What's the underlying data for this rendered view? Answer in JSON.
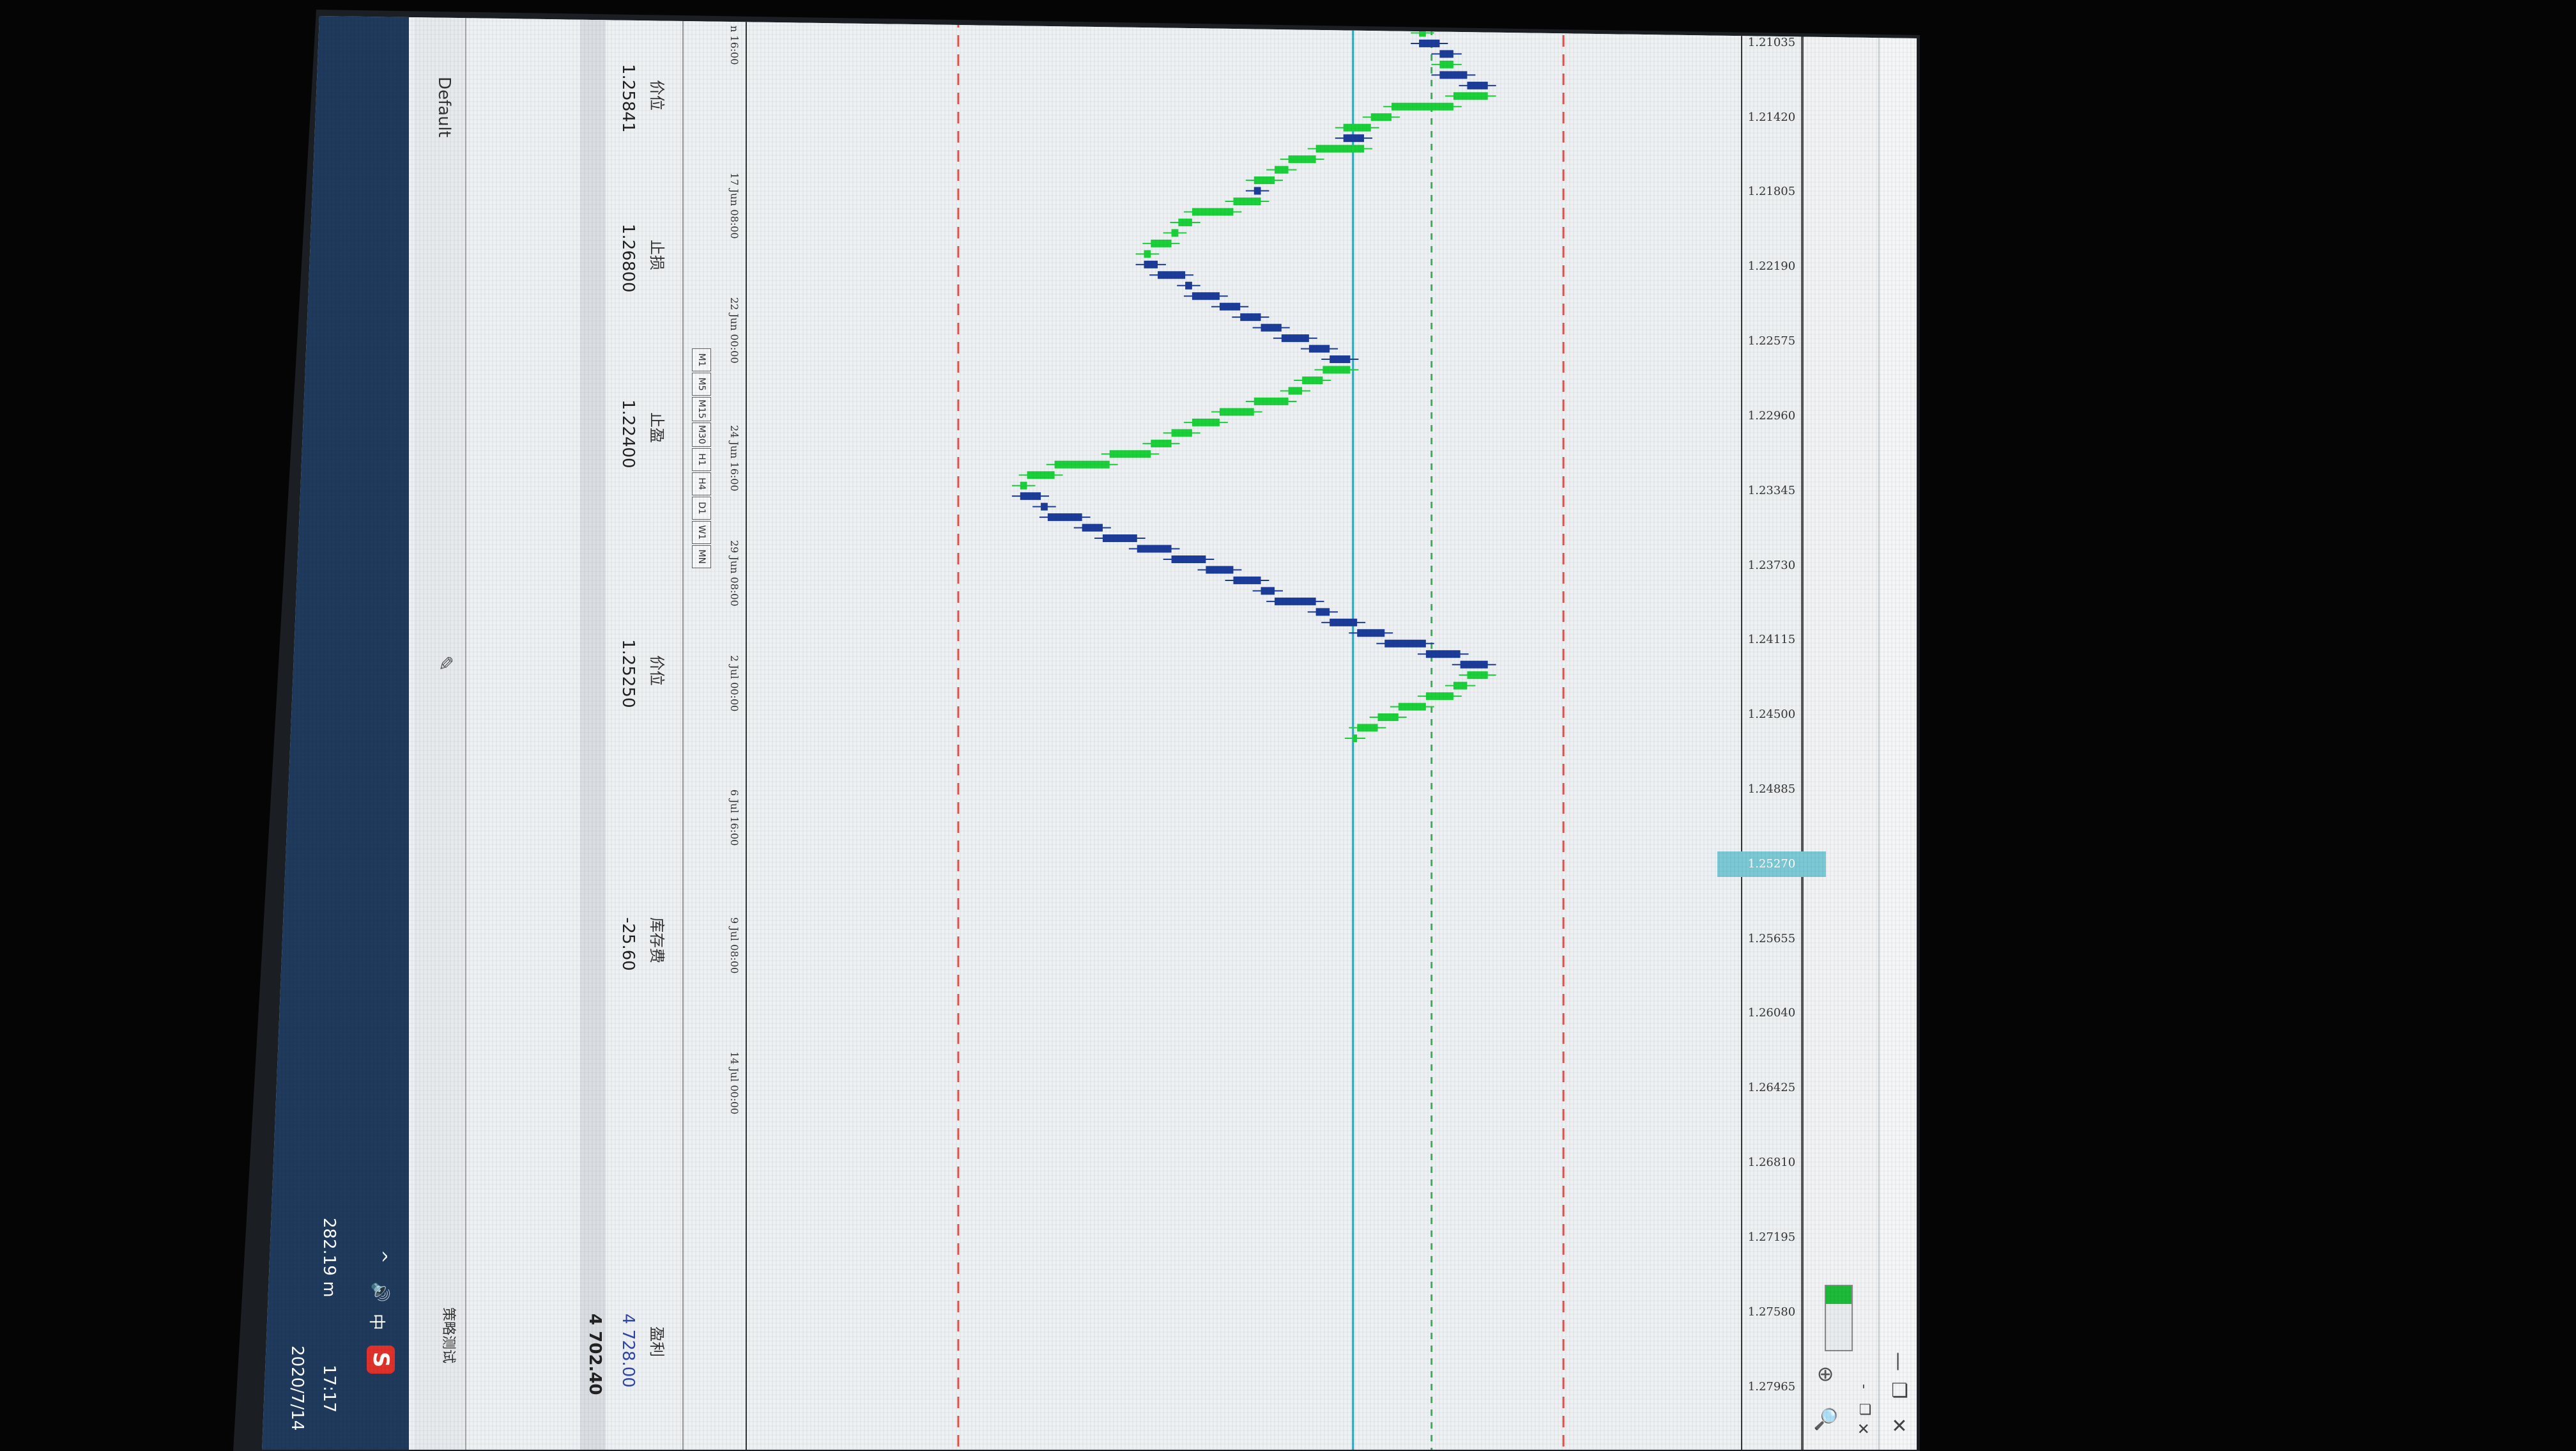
{
  "window": {
    "close_glyph": "✕",
    "restore_glyph": "❐",
    "minimize_glyph": "—",
    "mini_close": "✕",
    "mini_restore": "❐",
    "mini_min": "-"
  },
  "toolbar": {
    "zoom_icon": "🔍",
    "crosshair_icon": "⊕",
    "swatch_color": "#1dbb3a"
  },
  "price_axis": {
    "ticks": [
      "1.27965",
      "1.27580",
      "1.27195",
      "1.26810",
      "1.26425",
      "1.26040",
      "1.25655",
      "1.25270",
      "1.24885",
      "1.24500",
      "1.24115",
      "1.23730",
      "1.23345",
      "1.22960",
      "1.22575",
      "1.22190",
      "1.21805",
      "1.21420",
      "1.21035"
    ],
    "current_price": "1.25270"
  },
  "time_axis": {
    "labels": [
      "n 16:00",
      "17 Jun 08:00",
      "22 Jun 00:00",
      "24 Jun 16:00",
      "29 Jun 08:00",
      "2 Jul 00:00",
      "6 Jul 16:00",
      "9 Jul 08:00",
      "14 Jul 00:00"
    ],
    "period_buttons": [
      "M1",
      "M5",
      "M15",
      "M30",
      "H1",
      "H4",
      "D1",
      "W1",
      "MN"
    ]
  },
  "chart_lines": {
    "stop_loss_color": "#d9534f",
    "take_profit_color": "#d9534f",
    "entry_color": "#3cb55a",
    "current_color": "#2aa7b8",
    "bull_color": "#1bd13a",
    "bear_color": "#1c3c9a"
  },
  "order_panel": {
    "price_header": "价位",
    "price_value": "1.25841",
    "stop_loss_header": "止损",
    "stop_loss_value": "1.26800",
    "take_profit_header": "止盈",
    "take_profit_value": "1.22400",
    "close_price_header": "价位",
    "close_price_value": "1.25250",
    "swap_header": "库存费",
    "swap_value": "-25.60",
    "profit_header": "盈利",
    "profit_value": "4 728.00",
    "total_value": "4 702.40"
  },
  "bottom_tab": {
    "default_label": "Default",
    "strategy_label": "策略测试"
  },
  "taskbar": {
    "time": "17:17",
    "date": "2020/7/14",
    "network": "282.19 m",
    "ime": "中",
    "volume_icon": "🔊",
    "app_icon_letter": "S",
    "chevron": "^"
  }
}
